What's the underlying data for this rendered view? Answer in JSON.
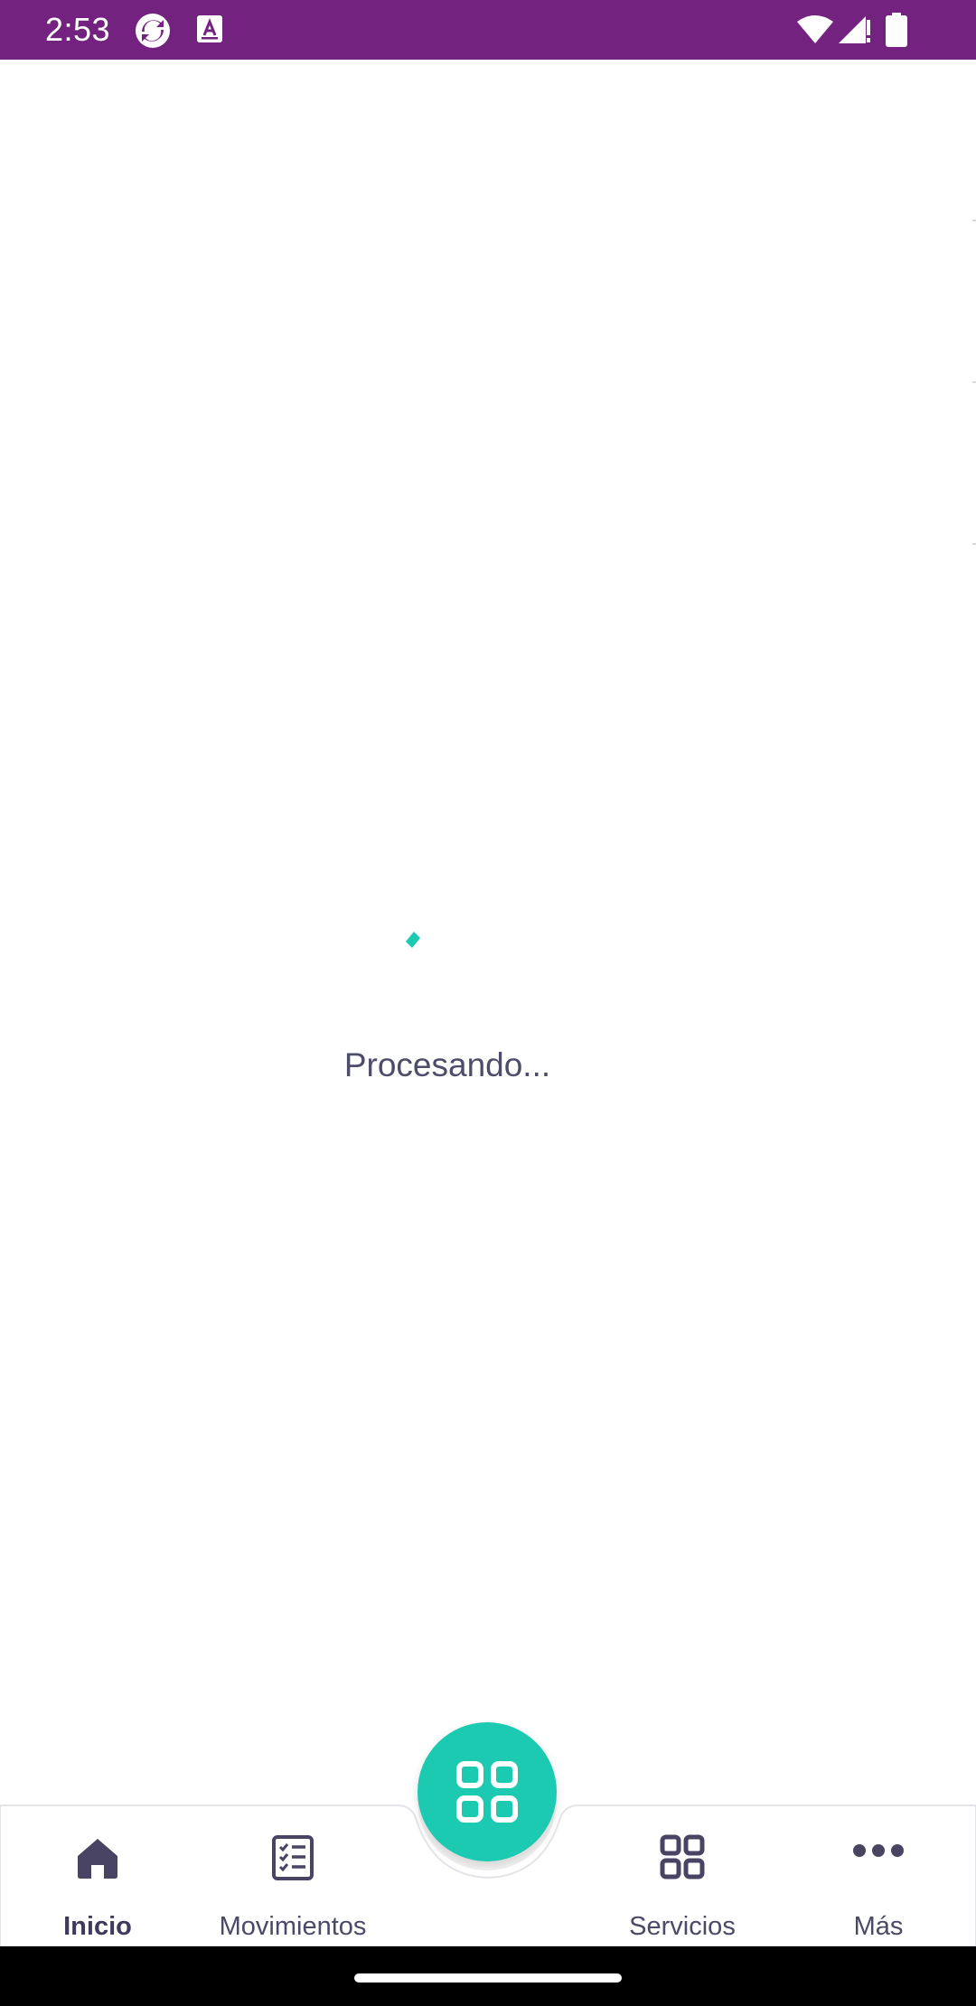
{
  "status_bar": {
    "time": "2:53",
    "left_icons": [
      "app-sync-icon",
      "keyboard-a-icon"
    ],
    "right_icons": [
      "wifi-icon",
      "cellular-signal-icon",
      "battery-icon"
    ],
    "background": "#73237f"
  },
  "main": {
    "loading_text": "Procesando...",
    "spinner_color": "#1ccab1"
  },
  "bottom_nav": {
    "items": [
      {
        "label": "Inicio",
        "icon": "home-icon",
        "active": true
      },
      {
        "label": "Movimientos",
        "icon": "checklist-icon",
        "active": false
      },
      {
        "label": "Servicios",
        "icon": "grid-icon",
        "active": false
      },
      {
        "label": "Más",
        "icon": "more-dots-icon",
        "active": false
      }
    ],
    "fab_icon": "qr-grid-icon",
    "fab_color": "#1ccab1"
  }
}
